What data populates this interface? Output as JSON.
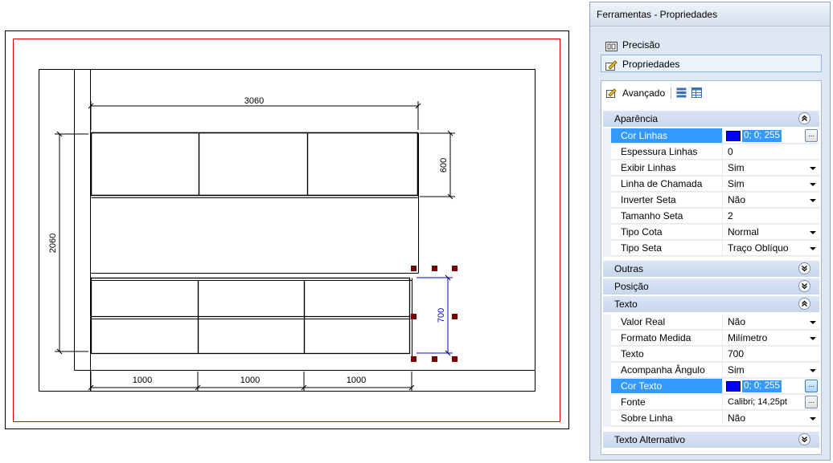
{
  "drawing": {
    "dim_top": "3060",
    "dim_left": "2060",
    "dim_right_upper": "600",
    "dim_selected": "700",
    "dim_bottom": [
      "1000",
      "1000",
      "1000"
    ],
    "selected_color": "#0000cc",
    "handle_color": "#7a0000",
    "border_color": "#e00000"
  },
  "panel": {
    "title": "Ferramentas - Propriedades",
    "nav": [
      {
        "label": "Precisão",
        "icon": "precision-icon"
      },
      {
        "label": "Propriedades",
        "icon": "properties-icon"
      }
    ],
    "toolbar": {
      "advanced_label": "Avançado",
      "icons": [
        "advanced-icon",
        "categorized-icon",
        "alphabetical-icon"
      ]
    },
    "categories": {
      "aparencia": {
        "label": "Aparência",
        "state": "expanded",
        "rows": [
          {
            "name": "Cor Linhas",
            "value": "0; 0; 255",
            "type": "color",
            "selected": true
          },
          {
            "name": "Espessura Linhas",
            "value": "0",
            "type": "text"
          },
          {
            "name": "Exibir Linhas",
            "value": "Sim",
            "type": "dropdown"
          },
          {
            "name": "Linha de Chamada",
            "value": "Sim",
            "type": "dropdown"
          },
          {
            "name": "Inverter Seta",
            "value": "Não",
            "type": "dropdown"
          },
          {
            "name": "Tamanho Seta",
            "value": "2",
            "type": "text"
          },
          {
            "name": "Tipo Cota",
            "value": "Normal",
            "type": "dropdown"
          },
          {
            "name": "Tipo Seta",
            "value": "Traço Oblíquo",
            "type": "dropdown"
          }
        ]
      },
      "outras": {
        "label": "Outras",
        "state": "collapsed"
      },
      "posicao": {
        "label": "Posição",
        "state": "collapsed"
      },
      "texto": {
        "label": "Texto",
        "state": "expanded",
        "rows": [
          {
            "name": "Valor Real",
            "value": "Não",
            "type": "dropdown"
          },
          {
            "name": "Formato Medida",
            "value": "Milímetro",
            "type": "dropdown"
          },
          {
            "name": "Texto",
            "value": "700",
            "type": "text"
          },
          {
            "name": "Acompanha Ângulo",
            "value": "Sim",
            "type": "dropdown"
          },
          {
            "name": "Cor Texto",
            "value": "0; 0; 255",
            "type": "color",
            "selected": true
          },
          {
            "name": "Fonte",
            "value": "Calibri; 14,25pt",
            "type": "button"
          },
          {
            "name": "Sobre Linha",
            "value": "Não",
            "type": "dropdown"
          }
        ]
      },
      "texto_alternativo": {
        "label": "Texto Alternativo",
        "state": "collapsed"
      }
    }
  }
}
